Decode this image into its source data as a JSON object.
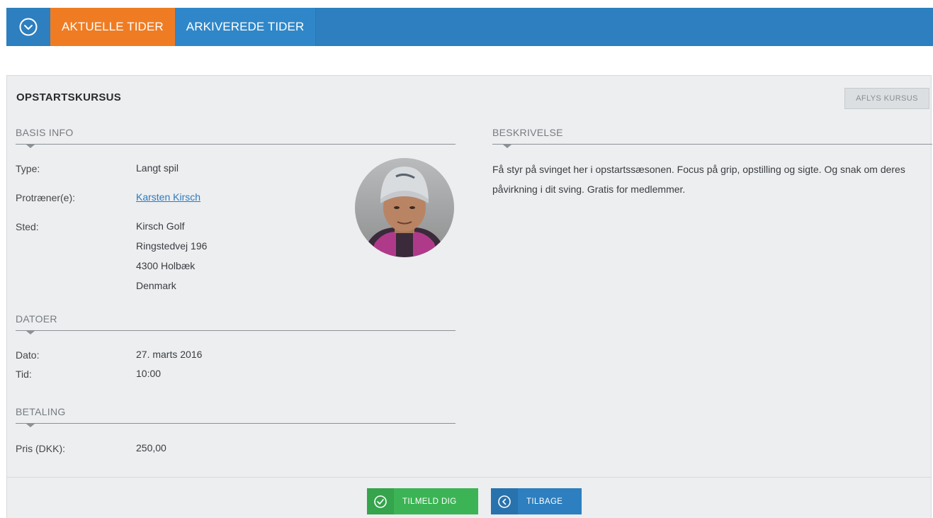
{
  "nav": {
    "tabs": [
      {
        "label": "AKTUELLE TIDER",
        "active": true
      },
      {
        "label": "ARKIVEREDE TIDER",
        "active": false
      }
    ]
  },
  "panel": {
    "title": "OPSTARTSKURSUS",
    "cancel_label": "AFLYS KURSUS"
  },
  "basis": {
    "heading": "BASIS INFO",
    "type_label": "Type:",
    "type_value": "Langt spil",
    "trainer_label": "Protræner(e):",
    "trainer_value": "Karsten Kirsch",
    "location_label": "Sted:",
    "location_lines": [
      "Kirsch Golf",
      "Ringstedvej 196",
      "4300 Holbæk",
      "Denmark"
    ]
  },
  "datoer": {
    "heading": "DATOER",
    "date_label": "Dato:",
    "date_value": "27. marts 2016",
    "time_label": "Tid:",
    "time_value": "10:00"
  },
  "betaling": {
    "heading": "BETALING",
    "price_label": "Pris (DKK):",
    "price_value": "250,00"
  },
  "beskrivelse": {
    "heading": "BESKRIVELSE",
    "text": "Få styr på svinget her i opstartssæsonen. Focus på grip, opstilling og sigte. Og snak om deres påvirkning i dit sving. Gratis for medlemmer."
  },
  "footer": {
    "signup_label": "TILMELD DIG",
    "back_label": "TILBAGE"
  },
  "colors": {
    "nav_blue": "#2d7fbf",
    "active_orange": "#ef7c23",
    "success_green": "#3cb455",
    "link_blue": "#2a7bbd",
    "panel_bg": "#eceef0"
  },
  "icons": {
    "nav_toggle": "chevron-down-circle-icon",
    "signup": "check-circle-icon",
    "back": "chevron-left-circle-icon"
  }
}
